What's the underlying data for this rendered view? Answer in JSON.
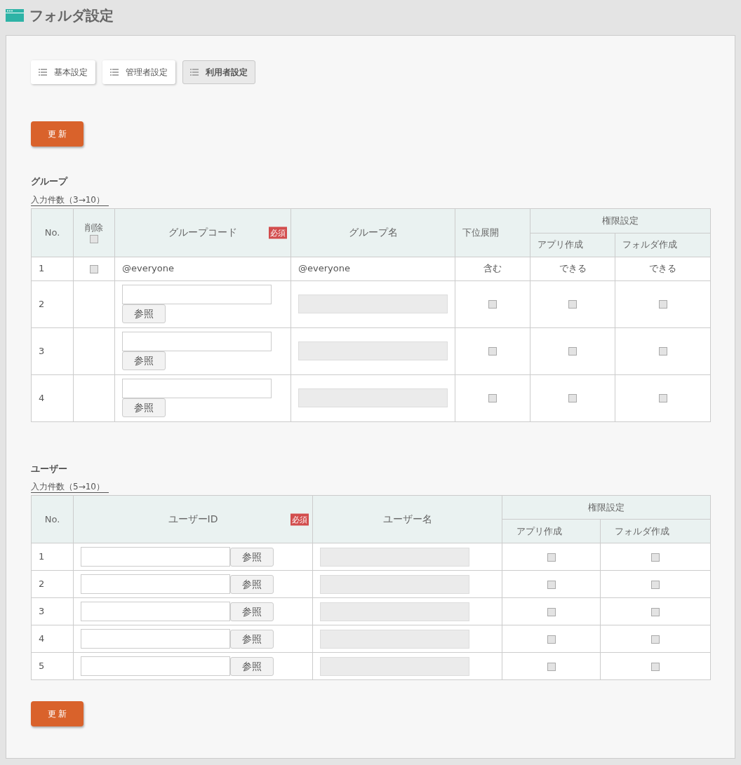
{
  "page": {
    "title": "フォルダ設定"
  },
  "tabs": [
    {
      "label": "基本設定",
      "selected": false
    },
    {
      "label": "管理者設定",
      "selected": false
    },
    {
      "label": "利用者設定",
      "selected": true
    }
  ],
  "update_buttons": [
    "更 新",
    "更 新"
  ],
  "group_section": {
    "title": "グループ",
    "count_link": "入力件数（3→10）",
    "columns": {
      "no": "No.",
      "delete": "削除",
      "code": "グループコード",
      "required": "必須",
      "name": "グループ名",
      "subordinate": "下位展開",
      "permissions": "権限設定",
      "app": "アプリ作成",
      "folder": "フォルダ作成"
    },
    "delete_all_checked": false,
    "rows": [
      {
        "kind": "fixed",
        "no": "1",
        "delete_checked": false,
        "code": "@everyone",
        "name": "@everyone",
        "subordinate": "含む",
        "app": "できる",
        "folder": "できる"
      },
      {
        "kind": "input",
        "no": "2",
        "browse": "参照",
        "subordinate_checked": false,
        "app_checked": false,
        "folder_checked": false
      },
      {
        "kind": "input",
        "no": "3",
        "browse": "参照",
        "subordinate_checked": false,
        "app_checked": false,
        "folder_checked": false
      },
      {
        "kind": "input",
        "no": "4",
        "browse": "参照",
        "subordinate_checked": false,
        "app_checked": false,
        "folder_checked": false
      }
    ]
  },
  "user_section": {
    "title": "ユーザー",
    "count_link": "入力件数（5→10）",
    "columns": {
      "no": "No.",
      "id": "ユーザーID",
      "required": "必須",
      "name": "ユーザー名",
      "permissions": "権限設定",
      "app": "アプリ作成",
      "folder": "フォルダ作成"
    },
    "rows": [
      {
        "no": "1",
        "browse": "参照",
        "app_checked": false,
        "folder_checked": false
      },
      {
        "no": "2",
        "browse": "参照",
        "app_checked": false,
        "folder_checked": false
      },
      {
        "no": "3",
        "browse": "参照",
        "app_checked": false,
        "folder_checked": false
      },
      {
        "no": "4",
        "browse": "参照",
        "app_checked": false,
        "folder_checked": false
      },
      {
        "no": "5",
        "browse": "参照",
        "app_checked": false,
        "folder_checked": false
      }
    ]
  }
}
